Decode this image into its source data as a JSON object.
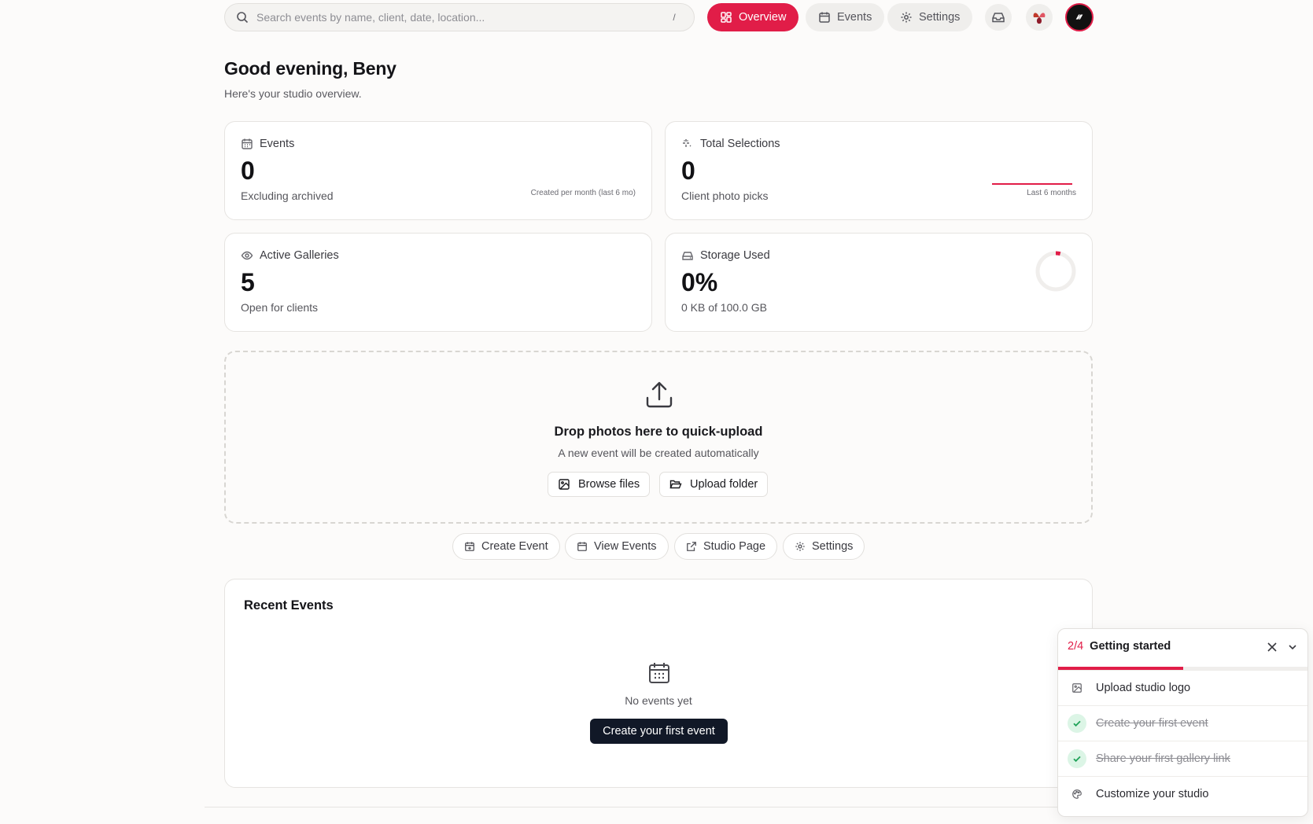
{
  "search": {
    "placeholder": "Search events by name, client, date, location...",
    "shortcut": "/"
  },
  "nav": [
    {
      "label": "Overview",
      "icon": "grid-icon",
      "active": true
    },
    {
      "label": "Events",
      "icon": "calendar-icon",
      "active": false
    },
    {
      "label": "Settings",
      "icon": "gear-icon",
      "active": false
    }
  ],
  "greeting": {
    "title": "Good evening, Beny",
    "subtitle": "Here's your studio overview."
  },
  "stats": {
    "events": {
      "label": "Events",
      "value": "0",
      "desc": "Excluding archived",
      "note": "Created per month (last 6 mo)"
    },
    "selections": {
      "label": "Total Selections",
      "value": "0",
      "desc": "Client photo picks",
      "note": "Last 6 months"
    },
    "galleries": {
      "label": "Active Galleries",
      "value": "5",
      "desc": "Open for clients"
    },
    "storage": {
      "label": "Storage Used",
      "value": "0%",
      "desc": "0 KB of 100.0 GB",
      "fraction": 0.0
    }
  },
  "dropzone": {
    "title": "Drop photos here to quick-upload",
    "subtitle": "A new event will be created automatically",
    "browse": "Browse files",
    "folder": "Upload folder"
  },
  "quick_actions": [
    "Create Event",
    "View Events",
    "Studio Page",
    "Settings"
  ],
  "recent": {
    "title": "Recent Events",
    "empty": "No events yet",
    "cta": "Create your first event"
  },
  "getting_started": {
    "progress": "2/4",
    "progress_fraction": 0.5,
    "title": "Getting started",
    "items": [
      {
        "label": "Upload studio logo",
        "done": false
      },
      {
        "label": "Create your first event",
        "done": true
      },
      {
        "label": "Share your first gallery link",
        "done": true
      },
      {
        "label": "Customize your studio",
        "done": false
      }
    ]
  },
  "colors": {
    "accent": "#e11d48",
    "dark": "#111827",
    "success": "#22a35a"
  }
}
